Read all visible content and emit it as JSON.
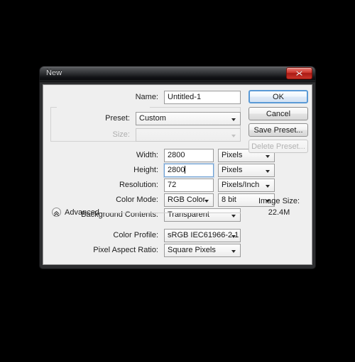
{
  "window": {
    "title": "New",
    "close_icon": "close-x-icon"
  },
  "form": {
    "name": {
      "label": "Name:",
      "value": "Untitled-1"
    },
    "preset": {
      "label": "Preset:",
      "value": "Custom"
    },
    "size": {
      "label": "Size:",
      "value": "",
      "disabled": true
    },
    "width": {
      "label": "Width:",
      "value": "2800",
      "unit": "Pixels"
    },
    "height": {
      "label": "Height:",
      "value": "2800",
      "unit": "Pixels",
      "focused": true
    },
    "resolution": {
      "label": "Resolution:",
      "value": "72",
      "unit": "Pixels/Inch"
    },
    "color_mode": {
      "label": "Color Mode:",
      "value": "RGB Color",
      "depth": "8 bit"
    },
    "background_contents": {
      "label": "Background Contents:",
      "value": "Transparent"
    },
    "advanced": {
      "label": "Advanced",
      "toggle_icon": "chevron-double-up-icon",
      "color_profile": {
        "label": "Color Profile:",
        "value": "sRGB IEC61966-2.1"
      },
      "pixel_aspect_ratio": {
        "label": "Pixel Aspect Ratio:",
        "value": "Square Pixels"
      }
    }
  },
  "buttons": {
    "ok": "OK",
    "cancel": "Cancel",
    "save_preset": "Save Preset...",
    "delete_preset": "Delete Preset..."
  },
  "image_size": {
    "label": "Image Size:",
    "value": "22.4M"
  },
  "colors": {
    "accent": "#5a9ad6",
    "close_red": "#cf3a30",
    "dialog_chrome": "#2c2d2f",
    "client_bg": "#efefef",
    "backdrop": "#000000"
  }
}
